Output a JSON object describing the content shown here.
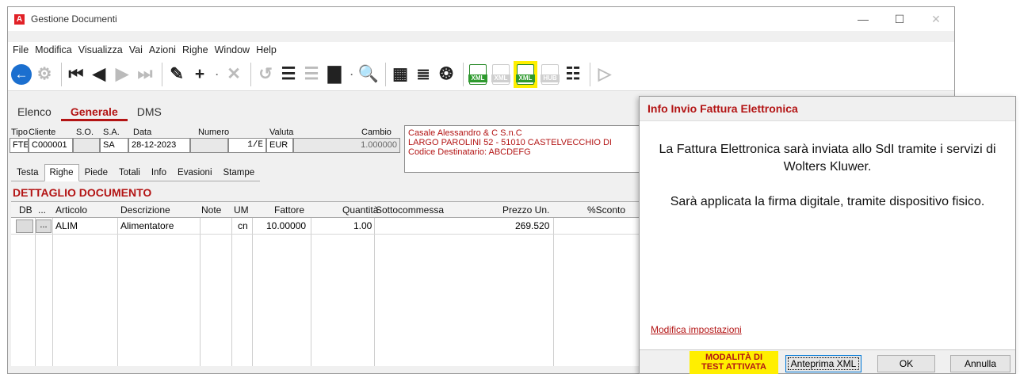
{
  "window": {
    "app_icon": "A",
    "title": "Gestione Documenti"
  },
  "win_controls": {
    "minimize": "—",
    "maximize": "☐",
    "close": "✕"
  },
  "menu": [
    "File",
    "Modifica",
    "Visualizza",
    "Vai",
    "Azioni",
    "Righe",
    "Window",
    "Help"
  ],
  "toolbar": {
    "back": "←",
    "settings": "⚙",
    "first": "⏮",
    "prev": "◀",
    "next": "▶",
    "last": "⏭",
    "edit": "✎",
    "add": "+",
    "dropdown": "·",
    "delete": "✕",
    "undo": "↺",
    "filter": "☰",
    "clear_filter": "☰",
    "print": "▇",
    "preview": "🔍",
    "calendar": "▦",
    "report": "≣",
    "link": "❂",
    "xml_label": "XML",
    "hub_label": "HUB",
    "list": "☷",
    "run": "▷",
    "highlight_color": "#ffef00"
  },
  "main_tabs": [
    "Elenco",
    "Generale",
    "DMS"
  ],
  "header": {
    "labels": {
      "tipo": "Tipo",
      "cliente": "Cliente",
      "so": "S.O.",
      "sa": "S.A.",
      "data": "Data",
      "numero": "Numero",
      "valuta": "Valuta",
      "cambio": "Cambio"
    },
    "values": {
      "tipo": "FTE",
      "cliente": "C000001",
      "so": "",
      "sa": "SA",
      "data": "28-12-2023",
      "numero_prefix": "",
      "numero": "1/E",
      "valuta": "EUR",
      "cambio": "1.000000"
    },
    "client_lines": [
      "Casale Alessandro & C S.n.C",
      "LARGO PAROLINI 52 - 51010 CASTELVECCHIO DI ",
      "Codice Destinatario: ABCDEFG"
    ]
  },
  "sub_tabs": [
    "Testa",
    "Righe",
    "Piede",
    "Totali",
    "Info",
    "Evasioni",
    "Stampe"
  ],
  "section_title": "DETTAGLIO DOCUMENTO",
  "grid": {
    "columns": [
      "DB",
      "...",
      "Articolo",
      "Descrizione",
      "Note",
      "UM",
      "Fattore",
      "Quantità",
      "Sottocommessa",
      "Prezzo Un.",
      "%Sconto"
    ],
    "rows": [
      {
        "db": "",
        "dots": "...",
        "articolo": "ALIM",
        "descrizione": "Alimentatore",
        "note": "",
        "um": "cn",
        "fattore": "10.00000",
        "quantita": "1.00",
        "sottocommessa": "",
        "prezzo": "269.520",
        "sconto": ""
      }
    ]
  },
  "dialog": {
    "title": "Info Invio Fattura Elettronica",
    "message1": "La Fattura Elettronica sarà inviata allo SdI tramite i servizi di Wolters Kluwer.",
    "message2": "Sarà applicata la firma digitale, tramite dispositivo fisico.",
    "link": "Modifica impostazioni",
    "test_badge_line1": "MODALITÀ DI",
    "test_badge_line2": "TEST ATTIVATA",
    "btn_preview": "Anteprima XML",
    "btn_ok": "OK",
    "btn_cancel": "Annulla"
  }
}
